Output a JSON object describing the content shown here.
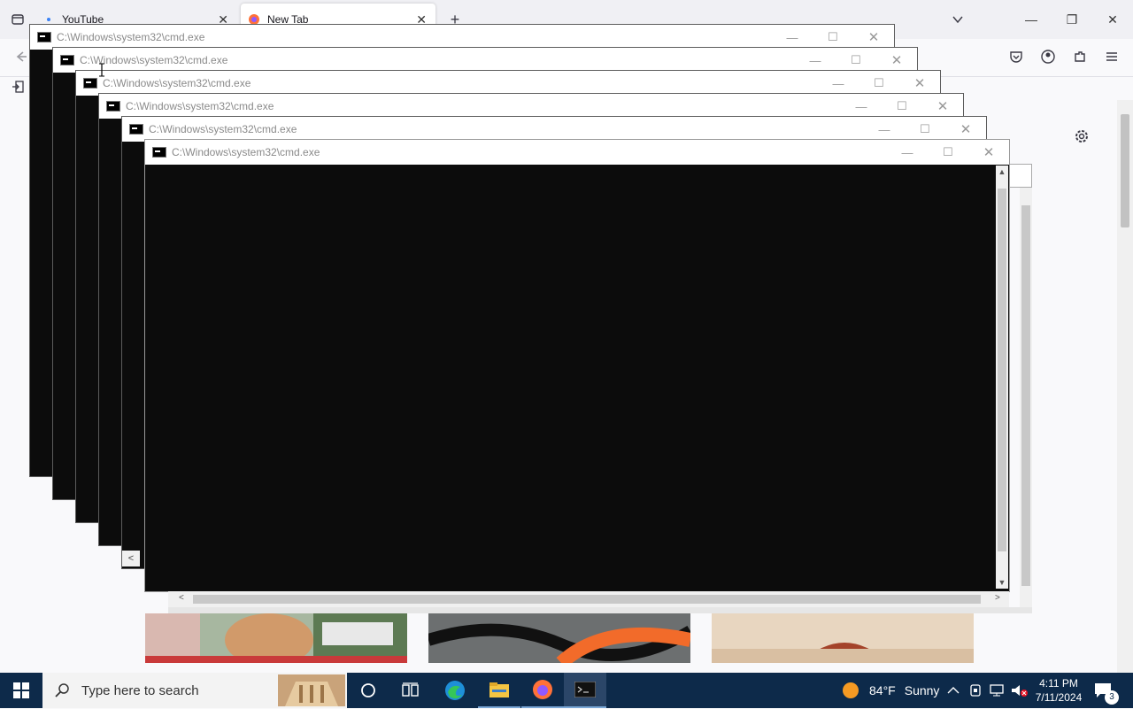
{
  "browser": {
    "tabs": [
      {
        "label": "YouTube",
        "close": "✕"
      },
      {
        "label": "New Tab",
        "close": "✕"
      }
    ],
    "new_tab_symbol": "+",
    "window_controls": {
      "minimize": "—",
      "restore": "❐",
      "close": "✕"
    }
  },
  "cmd_windows": [
    {
      "title": "C:\\Windows\\system32\\cmd.exe"
    },
    {
      "title": "C:\\Windows\\system32\\cmd.exe"
    },
    {
      "title": "C:\\Windows\\system32\\cmd.exe"
    },
    {
      "title": "C:\\Windows\\system32\\cmd.exe"
    },
    {
      "title": "C:\\Windows\\system32\\cmd.exe"
    },
    {
      "title": "C:\\Windows\\system32\\cmd.exe"
    }
  ],
  "cmd_controls": {
    "minimize": "—",
    "maximize": "☐",
    "close": "✕"
  },
  "taskbar": {
    "search_placeholder": "Type here to search",
    "weather": {
      "temp": "84°F",
      "condition": "Sunny"
    },
    "time": "4:11 PM",
    "date": "7/11/2024",
    "notification_count": "3"
  },
  "colors": {
    "taskbar": "#0d2a4a",
    "cmd_background": "#0c0c0c",
    "firefox_tabstrip": "#f0f0f4"
  }
}
